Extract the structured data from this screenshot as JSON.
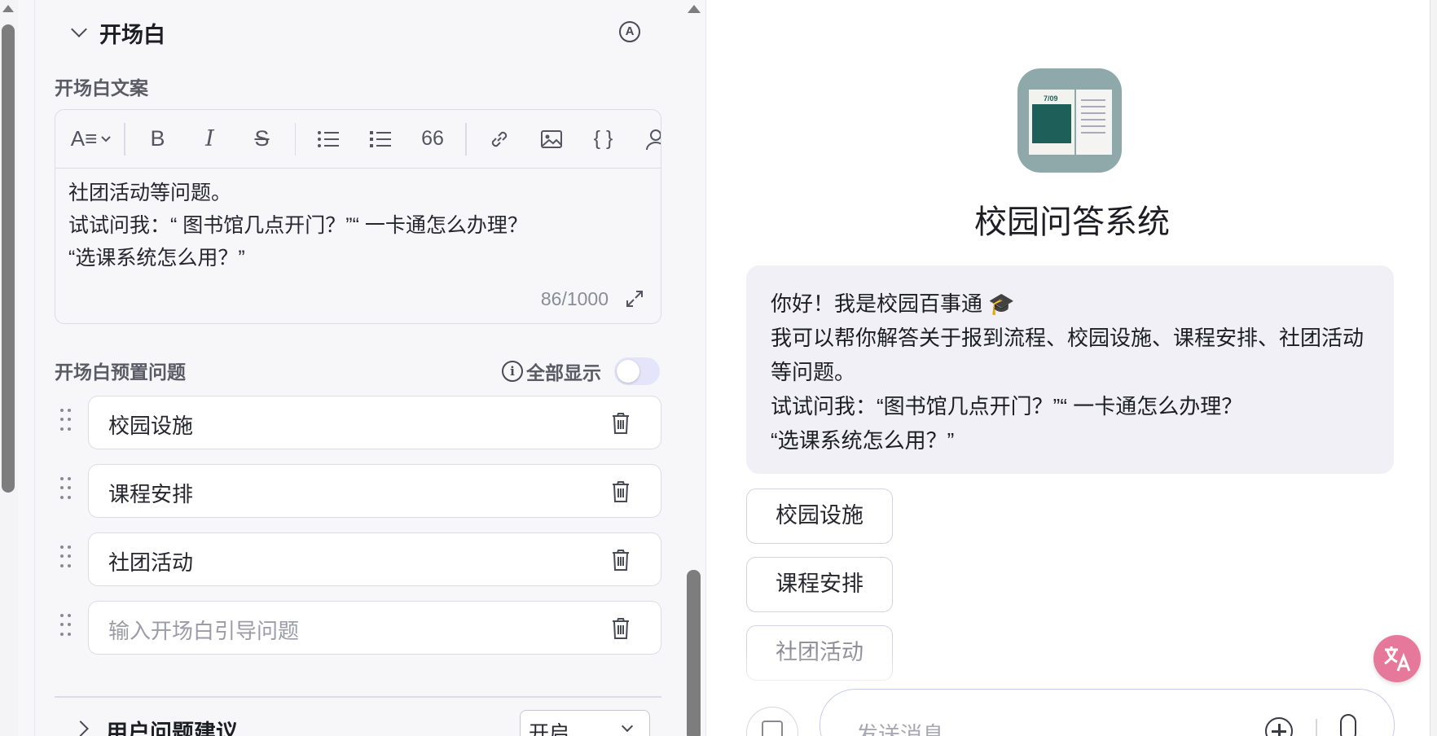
{
  "config": {
    "section_title": "开场白",
    "auto_badge": "A",
    "copy_label": "开场白文案",
    "editor": {
      "text": "社团活动等问题。\n试试问我：“ 图书馆几点开门？”“ 一卡通怎么办理？\n“选课系统怎么用？”",
      "counter": "86/1000",
      "toolbar": {
        "heading": "A≡",
        "bold": "B",
        "italic": "I",
        "strike": "S",
        "quote": "66",
        "code": "{ }"
      }
    },
    "preset_label": "开场白预置问题",
    "show_all": {
      "label": "全部显示",
      "info": "i",
      "enabled": false
    },
    "questions": [
      {
        "text": "校园设施"
      },
      {
        "text": "课程安排"
      },
      {
        "text": "社团活动"
      }
    ],
    "question_placeholder": "输入开场白引导问题",
    "suggestion_title": "用户问题建议",
    "suggestion_select": "开启"
  },
  "preview": {
    "bot_name": "校园问答系统",
    "avatar_text": "7/09",
    "greeting": "你好！我是校园百事通 🎓\n我可以帮你解答关于报到流程、校园设施、课程安排、社团活动等问题。\n试试问我：“图书馆几点开门？”“ 一卡通怎么办理？\n“选课系统怎么用？”",
    "chips": [
      "校园设施",
      "课程安排",
      "社团活动"
    ],
    "input_placeholder": "发送消息"
  },
  "colors": {
    "panel_bg": "#f7f7fa",
    "bubble_bg": "#f0f0f6",
    "toggle_off": "#e4e4fb",
    "translate_fab": "#e6789c",
    "input_border": "#c9c9f0"
  }
}
